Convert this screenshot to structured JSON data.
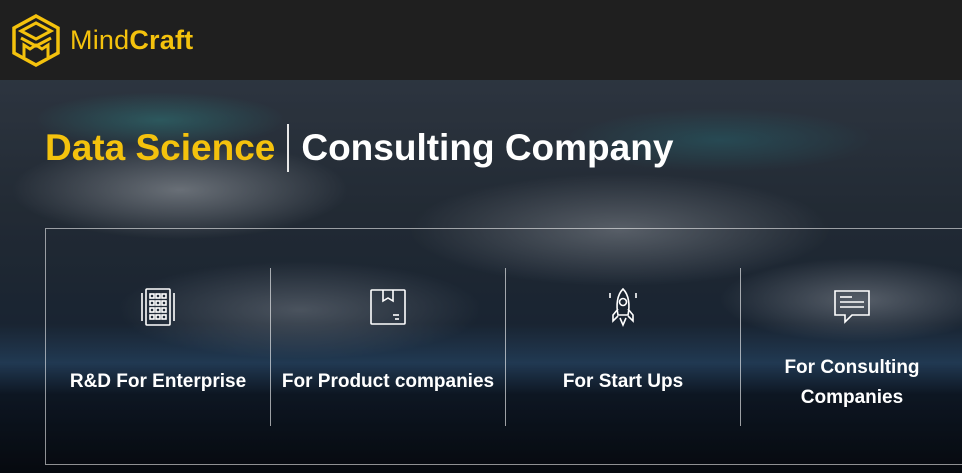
{
  "brand": {
    "name_regular": "Mind",
    "name_bold": "Craft",
    "logo_icon": "mindcraft-logo-icon",
    "accent_color": "#f4c20d"
  },
  "hero": {
    "headline_highlight": "Data Science",
    "headline_rest": "Consulting Company"
  },
  "services": [
    {
      "label": "R&D For Enterprise",
      "icon": "building-icon"
    },
    {
      "label": "For Product companies",
      "icon": "package-icon"
    },
    {
      "label": "For Start Ups",
      "icon": "rocket-icon"
    },
    {
      "label": "For Consulting Companies",
      "icon": "chat-bubble-icon"
    }
  ]
}
